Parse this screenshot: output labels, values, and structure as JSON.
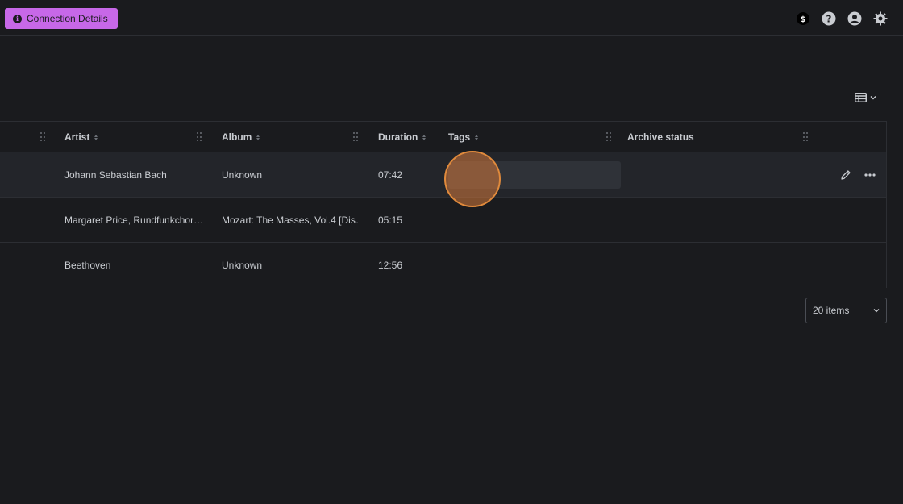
{
  "header": {
    "connection_button_label": "Connection Details",
    "icons": [
      "dollar-icon",
      "help-icon",
      "account-icon",
      "settings-icon"
    ]
  },
  "table": {
    "columns": [
      {
        "label": "Artist",
        "sortable": true
      },
      {
        "label": "Album",
        "sortable": true
      },
      {
        "label": "Duration",
        "sortable": true
      },
      {
        "label": "Tags",
        "sortable": true
      },
      {
        "label": "Archive status",
        "sortable": false
      }
    ],
    "rows": [
      {
        "artist": "Johann Sebastian Bach",
        "album": "Unknown",
        "duration": "07:42"
      },
      {
        "artist": "Margaret Price, Rundfunkchor…",
        "album": "Mozart: The Masses, Vol.4 [Dis…",
        "duration": "05:15"
      },
      {
        "artist": "Beethoven",
        "album": "Unknown",
        "duration": "12:56"
      }
    ]
  },
  "pagination": {
    "page_size_label": "20 items"
  },
  "colors": {
    "accent": "#c768e8",
    "background": "#1a1b1e",
    "cursor": "#e08a3c"
  }
}
